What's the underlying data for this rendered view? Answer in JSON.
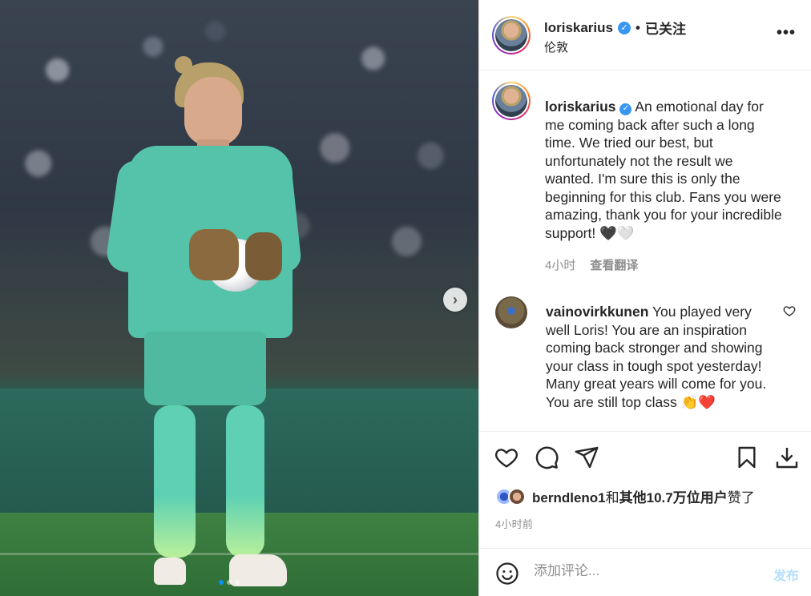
{
  "post": {
    "carousel": {
      "total_slides": 3,
      "active_index": 0
    }
  },
  "header": {
    "username": "loriskarius",
    "follow_state": "已关注",
    "separator": "•",
    "location": "伦敦",
    "more_label": "•••"
  },
  "caption": {
    "username": "loriskarius",
    "text": "An emotional day for me coming back after such a long time. We tried our best, but unfortunately not the result we wanted. I'm sure this is only the beginning for this club. Fans you were amazing, thank you for your incredible support! 🖤🤍",
    "time": "4小时",
    "translate": "查看翻译"
  },
  "comment": {
    "username": "vainovirkkunen",
    "text": "You played very well Loris! You are an inspiration coming back stronger and showing your class in tough spot yesterday! Many great years will come for you. You are still top class 👏❤️"
  },
  "likes": {
    "first_liker": "berndleno1",
    "connector": "和",
    "others": "其他10.7万位用户",
    "suffix": "赞了"
  },
  "post_time": "4小时前",
  "add_comment": {
    "placeholder": "添加评论...",
    "post_label": "发布"
  },
  "colors": {
    "accent_blue": "#0095f6",
    "verified_blue": "#3897f0",
    "post_disabled": "#b2dffc"
  },
  "icons": [
    "verified-icon",
    "more-icon",
    "chevron-right-icon",
    "heart-icon",
    "comment-icon",
    "share-icon",
    "bookmark-icon",
    "download-icon",
    "emoji-icon"
  ]
}
